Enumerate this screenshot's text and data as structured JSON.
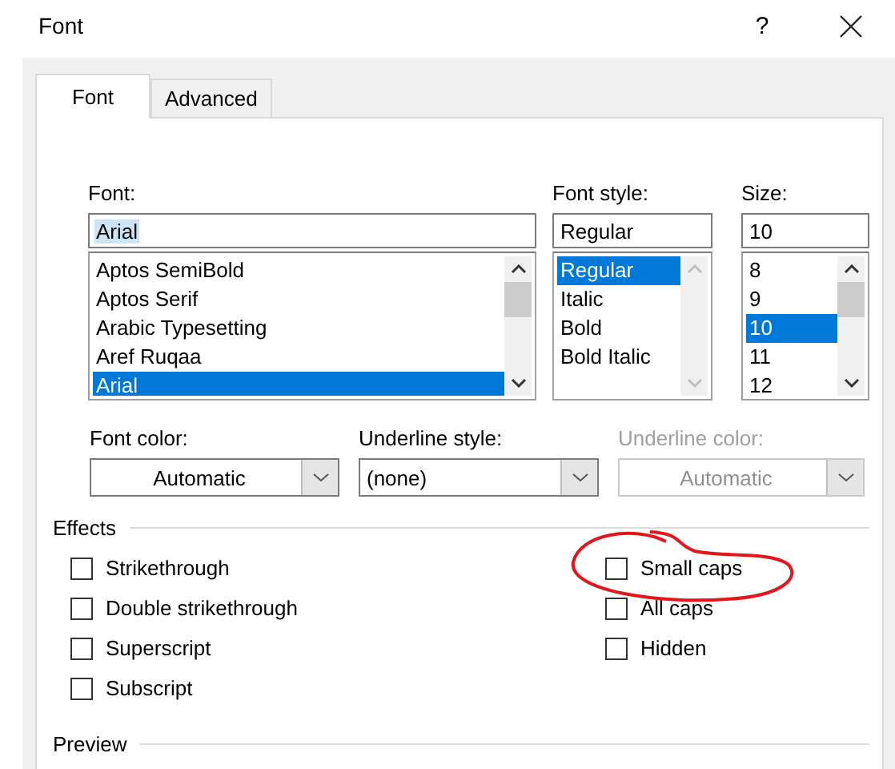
{
  "window": {
    "title": "Font",
    "help": "?"
  },
  "tabs": [
    {
      "label": "Font",
      "selected": true
    },
    {
      "label": "Advanced",
      "selected": false
    }
  ],
  "font": {
    "label": "Font:",
    "value": "Arial",
    "value_selected": true,
    "scrollbar_enabled": true,
    "items": [
      {
        "label": "Aptos SemiBold",
        "selected": false
      },
      {
        "label": "Aptos Serif",
        "selected": false
      },
      {
        "label": "Arabic Typesetting",
        "selected": false
      },
      {
        "label": "Aref Ruqaa",
        "selected": false
      },
      {
        "label": "Arial",
        "selected": true
      }
    ]
  },
  "font_style": {
    "label": "Font style:",
    "value": "Regular",
    "value_selected": false,
    "scrollbar_enabled": false,
    "items": [
      {
        "label": "Regular",
        "selected": true
      },
      {
        "label": "Italic",
        "selected": false
      },
      {
        "label": "Bold",
        "selected": false
      },
      {
        "label": "Bold Italic",
        "selected": false
      }
    ]
  },
  "size": {
    "label": "Size:",
    "value": "10",
    "value_selected": false,
    "scrollbar_enabled": true,
    "items": [
      {
        "label": "8",
        "selected": false
      },
      {
        "label": "9",
        "selected": false
      },
      {
        "label": "10",
        "selected": true
      },
      {
        "label": "11",
        "selected": false
      },
      {
        "label": "12",
        "selected": false
      }
    ]
  },
  "dropdowns": [
    {
      "label": "Font color:",
      "value": "Automatic",
      "centered": true,
      "disabled": false
    },
    {
      "label": "Underline style:",
      "value": "(none)",
      "centered": false,
      "disabled": false
    },
    {
      "label": "Underline color:",
      "value": "Automatic",
      "centered": true,
      "disabled": true
    }
  ],
  "effects": {
    "title": "Effects",
    "left": [
      {
        "label": "Strikethrough",
        "checked": false
      },
      {
        "label": "Double strikethrough",
        "checked": false
      },
      {
        "label": "Superscript",
        "checked": false
      },
      {
        "label": "Subscript",
        "checked": false
      }
    ],
    "right": [
      {
        "label": "Small caps",
        "checked": false
      },
      {
        "label": "All caps",
        "checked": false
      },
      {
        "label": "Hidden",
        "checked": false
      }
    ]
  },
  "preview": {
    "title": "Preview"
  }
}
